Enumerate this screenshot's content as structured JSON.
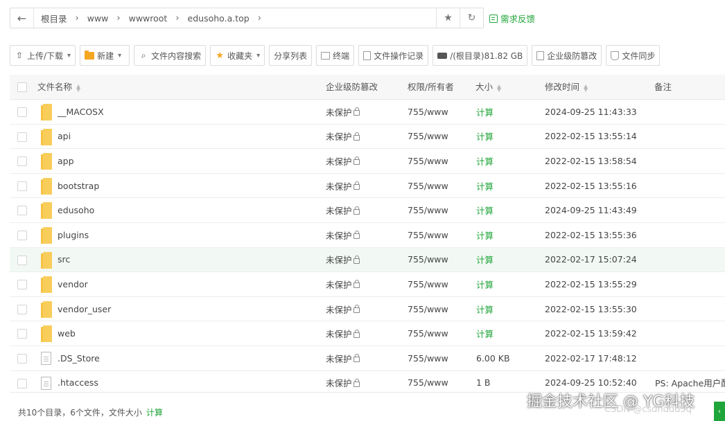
{
  "address_bar": {
    "back_icon": "arrow-left-icon",
    "crumbs": [
      "根目录",
      "www",
      "wwwroot",
      "edusoho.a.top"
    ],
    "favorite_icon": "star-icon",
    "refresh_icon": "refresh-icon"
  },
  "feedback": {
    "label": "需求反馈"
  },
  "toolbar": {
    "upload": "上传/下载",
    "new": "新建",
    "search": "文件内容搜索",
    "favorites": "收藏夹",
    "share": "分享列表",
    "terminal": "终端",
    "oplog": "文件操作记录",
    "disk": "/(根目录)81.82 GB",
    "tamper": "企业级防篡改",
    "sync": "文件同步"
  },
  "table": {
    "headers": {
      "name": "文件名称",
      "tamper": "企业级防篡改",
      "perm": "权限/所有者",
      "size": "大小",
      "mtime": "修改时间",
      "note": "备注"
    },
    "rows": [
      {
        "type": "folder",
        "name": "__MACOSX",
        "tamper": "未保护",
        "perm": "755/www",
        "size": "计算",
        "mtime": "2024-09-25 11:43:33",
        "note": ""
      },
      {
        "type": "folder",
        "name": "api",
        "tamper": "未保护",
        "perm": "755/www",
        "size": "计算",
        "mtime": "2022-02-15 13:55:14",
        "note": ""
      },
      {
        "type": "folder",
        "name": "app",
        "tamper": "未保护",
        "perm": "755/www",
        "size": "计算",
        "mtime": "2022-02-15 13:58:54",
        "note": ""
      },
      {
        "type": "folder",
        "name": "bootstrap",
        "tamper": "未保护",
        "perm": "755/www",
        "size": "计算",
        "mtime": "2022-02-15 13:55:16",
        "note": ""
      },
      {
        "type": "folder",
        "name": "edusoho",
        "tamper": "未保护",
        "perm": "755/www",
        "size": "计算",
        "mtime": "2024-09-25 11:43:49",
        "note": ""
      },
      {
        "type": "folder",
        "name": "plugins",
        "tamper": "未保护",
        "perm": "755/www",
        "size": "计算",
        "mtime": "2022-02-15 13:55:36",
        "note": ""
      },
      {
        "type": "folder",
        "name": "src",
        "tamper": "未保护",
        "perm": "755/www",
        "size": "计算",
        "mtime": "2022-02-17 15:07:24",
        "note": ""
      },
      {
        "type": "folder",
        "name": "vendor",
        "tamper": "未保护",
        "perm": "755/www",
        "size": "计算",
        "mtime": "2022-02-15 13:55:29",
        "note": ""
      },
      {
        "type": "folder",
        "name": "vendor_user",
        "tamper": "未保护",
        "perm": "755/www",
        "size": "计算",
        "mtime": "2022-02-15 13:55:30",
        "note": ""
      },
      {
        "type": "folder",
        "name": "web",
        "tamper": "未保护",
        "perm": "755/www",
        "size": "计算",
        "mtime": "2022-02-15 13:59:42",
        "note": ""
      },
      {
        "type": "file",
        "name": ".DS_Store",
        "tamper": "未保护",
        "perm": "755/www",
        "size": "6.00 KB",
        "mtime": "2022-02-17 17:48:12",
        "note": ""
      },
      {
        "type": "file",
        "name": ".htaccess",
        "tamper": "未保护",
        "perm": "755/www",
        "size": "1 B",
        "mtime": "2024-09-25 10:52:40",
        "note": "PS: Apache用户配"
      }
    ]
  },
  "footer": {
    "summary": "共10个目录，6个文件，文件大小",
    "calc": "计算"
  },
  "watermark": {
    "main": "掘金技术社区 @ YG科技",
    "sub": "CSDN @csdnddd5q"
  },
  "colors": {
    "accent": "#20a53a",
    "folder": "#f6c244"
  }
}
